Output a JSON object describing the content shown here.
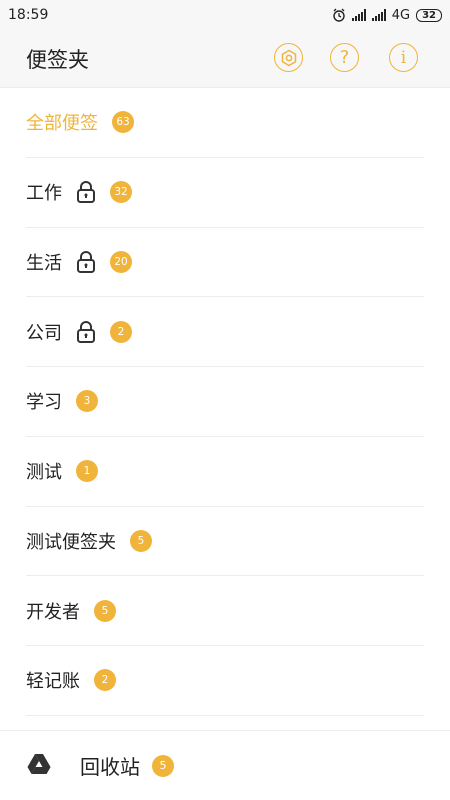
{
  "status": {
    "time": "18:59",
    "network": "4G",
    "battery": "32"
  },
  "header": {
    "title": "便签夹"
  },
  "folders": [
    {
      "label": "全部便签",
      "count": "63",
      "locked": false,
      "active": true
    },
    {
      "label": "工作",
      "count": "32",
      "locked": true,
      "active": false
    },
    {
      "label": "生活",
      "count": "20",
      "locked": true,
      "active": false
    },
    {
      "label": "公司",
      "count": "2",
      "locked": true,
      "active": false
    },
    {
      "label": "学习",
      "count": "3",
      "locked": false,
      "active": false
    },
    {
      "label": "测试",
      "count": "1",
      "locked": false,
      "active": false
    },
    {
      "label": "测试便签夹",
      "count": "5",
      "locked": false,
      "active": false
    },
    {
      "label": "开发者",
      "count": "5",
      "locked": false,
      "active": false
    },
    {
      "label": "轻记账",
      "count": "2",
      "locked": false,
      "active": false
    }
  ],
  "bottom": {
    "label": "回收站",
    "count": "5"
  },
  "colors": {
    "accent": "#f0b43a",
    "divider": "#ececec",
    "header_bg": "#f7f7f7"
  },
  "icons": [
    "settings-gear-icon",
    "help-icon",
    "info-icon",
    "lock-icon",
    "trash-drive-icon"
  ]
}
